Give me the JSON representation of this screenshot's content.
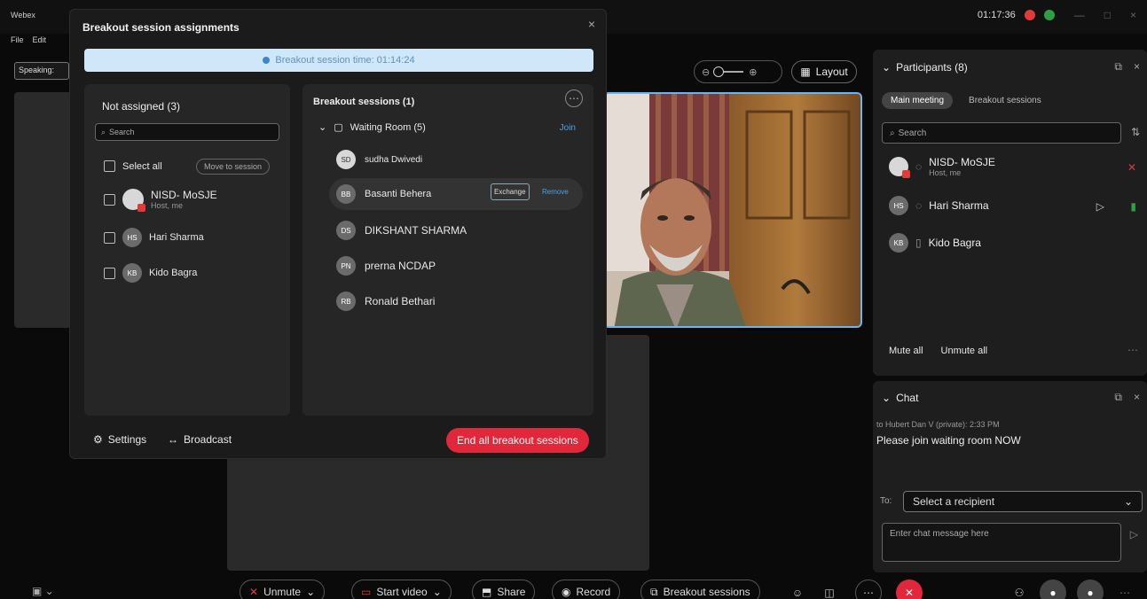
{
  "app": {
    "title": "Webex",
    "menu": [
      "File",
      "Edit"
    ],
    "time": "01:17:36",
    "colors": {
      "record_red": "#e23a3a",
      "connected_green": "#2ea043",
      "end_red": "#e0283a",
      "video_border": "#6fb3e8"
    }
  },
  "stage": {
    "speaking_label": "Speaking:"
  },
  "video_controls": {
    "layout_label": "Layout"
  },
  "breakout_modal": {
    "title": "Breakout session assignments",
    "timer": "Breakout session time: 01:14:24",
    "not_assigned": {
      "heading": "Not assigned (3)",
      "search_placeholder": "Search",
      "select_all": "Select all",
      "move_button": "Move to session",
      "people": [
        {
          "initials": "",
          "name": "NISD- MoSJE",
          "sub": "Host, me",
          "icon": "photo-avatar"
        },
        {
          "initials": "HS",
          "name": "Hari Sharma",
          "sub": ""
        },
        {
          "initials": "KB",
          "name": "Kido Bagra",
          "sub": ""
        }
      ]
    },
    "sessions": {
      "heading": "Breakout sessions (1)",
      "room_name": "Waiting Room (5)",
      "add_label": "Join",
      "members": [
        {
          "initials": "SD",
          "name": "sudha Dwivedi"
        },
        {
          "initials": "BB",
          "name": "Basanti Behera",
          "exchange": "Exchange",
          "remove": "Remove"
        },
        {
          "initials": "DS",
          "name": "DIKSHANT SHARMA"
        },
        {
          "initials": "PN",
          "name": "prerna NCDAP"
        },
        {
          "initials": "RB",
          "name": "Ronald Bethari"
        }
      ]
    },
    "footer": {
      "settings": "Settings",
      "broadcast": "Broadcast",
      "end_button": "End all breakout sessions"
    }
  },
  "participants_panel": {
    "title": "Participants (8)",
    "tabs": [
      "Main meeting",
      "Breakout sessions"
    ],
    "search_placeholder": "Search",
    "people": [
      {
        "initials": "",
        "name": "NISD- MoSJE",
        "sub": "Host, me"
      },
      {
        "initials": "HS",
        "name": "Hari Sharma",
        "sub": ""
      },
      {
        "initials": "KB",
        "name": "Kido Bagra",
        "sub": ""
      }
    ],
    "mute_all": "Mute all",
    "unmute_all": "Unmute all"
  },
  "chat_panel": {
    "title": "Chat",
    "message_meta": "to Hubert Dan V (private):   2:33 PM",
    "message_text": "Please join waiting room NOW",
    "to_label": "To:",
    "recipient": "Select a recipient",
    "input_placeholder": "Enter chat message here"
  },
  "bottom_bar": {
    "unmute": "Unmute",
    "start_video": "Start video",
    "share": "Share",
    "record": "Record",
    "breakout": "Breakout sessions"
  }
}
